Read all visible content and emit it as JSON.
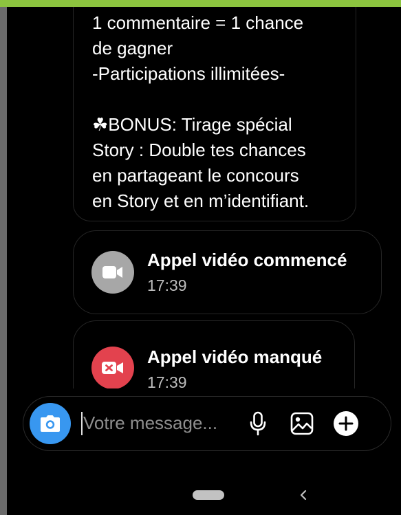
{
  "message": {
    "lines": "1 commentaire = 1 chance\nde gagner\n-Participations illimitées-\n\n☘BONUS: Tirage spécial\nStory : Double tes chances\nen partageant le concours\nen Story et en m’identifiant."
  },
  "calls": [
    {
      "title": "Appel vidéo commencé",
      "time": "17:39",
      "icon": "video-camera-icon",
      "color": "#a7a7a7"
    },
    {
      "title": "Appel vidéo manqué",
      "time": "17:39",
      "icon": "video-missed-icon",
      "color": "#e3424e"
    }
  ],
  "composer": {
    "placeholder": "Votre message...",
    "value": "",
    "camera_icon": "camera-icon",
    "mic_icon": "microphone-icon",
    "gallery_icon": "image-icon",
    "plus_icon": "plus-icon",
    "accent": "#3897f0"
  },
  "nav": {
    "home_icon": "home-pill-icon",
    "back_icon": "back-chevron-icon"
  },
  "colors": {
    "top_bar": "#8cc43f",
    "background": "#000000"
  }
}
